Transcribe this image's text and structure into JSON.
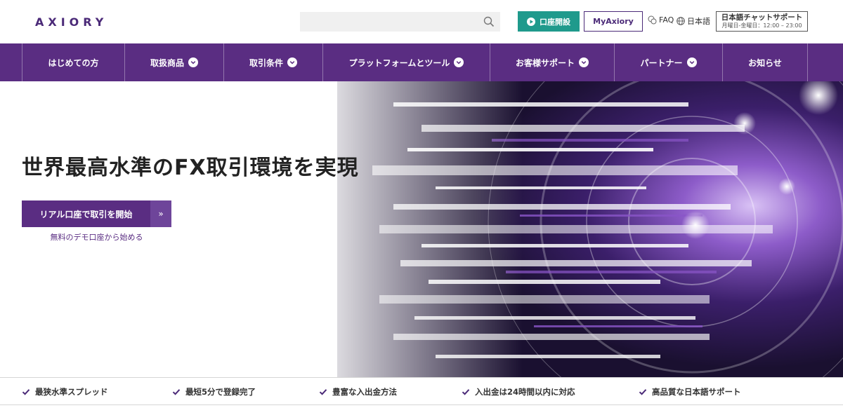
{
  "header": {
    "logo": "AXIORY",
    "search_placeholder": "",
    "open_account_label": "口座開設",
    "myaxiory_label": "MyAxiory",
    "faq_label": "FAQ",
    "language_label": "日本語",
    "chat_title": "日本語チャットサポート",
    "chat_hours": "月曜日-金曜日：12:00 – 23:00"
  },
  "nav": {
    "items": [
      {
        "label": "はじめての方",
        "dropdown": false
      },
      {
        "label": "取扱商品",
        "dropdown": true
      },
      {
        "label": "取引条件",
        "dropdown": true
      },
      {
        "label": "プラットフォームとツール",
        "dropdown": true
      },
      {
        "label": "お客様サポート",
        "dropdown": true
      },
      {
        "label": "パートナー",
        "dropdown": true
      },
      {
        "label": "お知らせ",
        "dropdown": false
      }
    ]
  },
  "hero": {
    "headline": "世界最高水準のFX取引環境を実現",
    "cta_label": "リアル口座で取引を開始",
    "cta_arrow": "»",
    "demo_link": "無料のデモ口座から始める"
  },
  "features": [
    "最狭水準スプレッド",
    "最短5分で登録完了",
    "豊富な入出金方法",
    "入出金は24時間以内に対応",
    "高品質な日本語サポート"
  ],
  "colors": {
    "brand_purple": "#5a2d82",
    "accent_teal": "#1f9a8c",
    "logo_purple": "#4b2a78"
  }
}
